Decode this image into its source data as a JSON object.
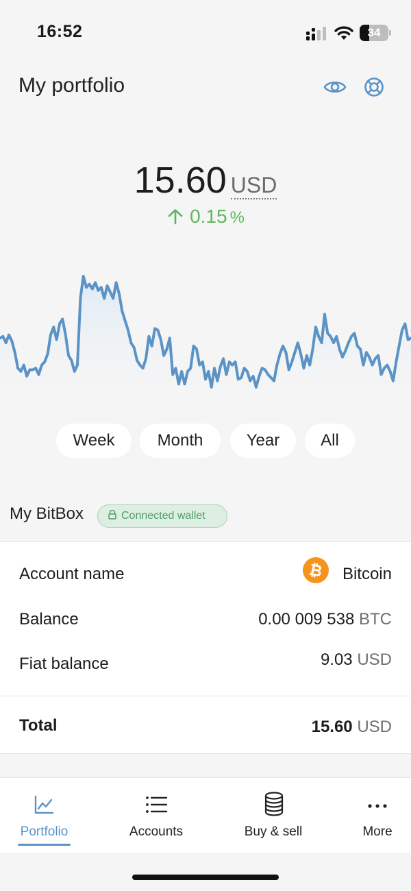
{
  "status_bar": {
    "time": "16:52",
    "battery_level": "34"
  },
  "header": {
    "title": "My portfolio"
  },
  "portfolio": {
    "amount": "15.60",
    "unit": "USD",
    "change_value": "0.15",
    "change_unit": "%"
  },
  "chart_data": {
    "type": "area",
    "values": [
      45,
      46,
      42,
      47,
      43,
      36,
      26,
      24,
      28,
      21,
      25,
      25,
      26,
      22,
      28,
      30,
      35,
      47,
      52,
      44,
      54,
      57,
      47,
      34,
      31,
      24,
      28,
      70,
      84,
      77,
      79,
      76,
      80,
      75,
      77,
      70,
      78,
      74,
      70,
      80,
      73,
      62,
      56,
      50,
      42,
      39,
      31,
      28,
      26,
      32,
      46,
      40,
      51,
      50,
      44,
      34,
      38,
      45,
      22,
      26,
      16,
      24,
      16,
      24,
      26,
      40,
      38,
      28,
      30,
      19,
      24,
      14,
      26,
      18,
      27,
      32,
      22,
      30,
      28,
      30,
      19,
      20,
      26,
      24,
      18,
      21,
      14,
      21,
      26,
      25,
      22,
      20,
      18,
      28,
      35,
      40,
      36,
      25,
      30,
      36,
      42,
      35,
      26,
      34,
      28,
      38,
      52,
      46,
      42,
      60,
      48,
      46,
      42,
      46,
      38,
      33,
      37,
      42,
      46,
      48,
      40,
      38,
      28,
      36,
      33,
      28,
      32,
      34,
      22,
      26,
      28,
      24,
      18,
      30,
      40,
      50,
      54,
      44,
      45
    ],
    "line_color": "#5b93c6"
  },
  "range_tabs": {
    "items": [
      {
        "label": "Week"
      },
      {
        "label": "Month"
      },
      {
        "label": "Year"
      },
      {
        "label": "All"
      }
    ],
    "selected": "Year"
  },
  "device": {
    "label": "My BitBox",
    "badge": "Connected wallet"
  },
  "account": {
    "name_label": "Account name",
    "name_value": "Bitcoin",
    "balance_label": "Balance",
    "balance_value": "0.00 009 538",
    "balance_unit": "BTC",
    "fiat_label": "Fiat balance",
    "fiat_value": "9.03",
    "fiat_unit": "USD",
    "total_label": "Total",
    "total_value": "15.60",
    "total_unit": "USD"
  },
  "bottom_nav": {
    "items": [
      {
        "label": "Portfolio",
        "icon": "chart-icon"
      },
      {
        "label": "Accounts",
        "icon": "list-icon"
      },
      {
        "label": "Buy & sell",
        "icon": "coins-icon"
      },
      {
        "label": "More",
        "icon": "more-icon"
      }
    ],
    "active": "Portfolio"
  },
  "colors": {
    "accent": "#5b93c6",
    "positive": "#5cb85c",
    "bitcoin": "#f7931a"
  }
}
